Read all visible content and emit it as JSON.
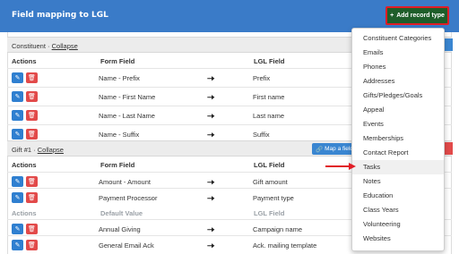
{
  "header": {
    "title": "Field mapping to LGL",
    "add_button": "Add record type",
    "add_icon": "+"
  },
  "sections": [
    {
      "label": "Constituent",
      "separator": " · ",
      "collapse": "Collapse",
      "columns": {
        "actions": "Actions",
        "form_field": "Form Field",
        "lgl_field": "LGL Field"
      },
      "rows": [
        {
          "form_field": "Name - Prefix",
          "lgl_field": "Prefix"
        },
        {
          "form_field": "Name - First Name",
          "lgl_field": "First name"
        },
        {
          "form_field": "Name - Last Name",
          "lgl_field": "Last name"
        },
        {
          "form_field": "Name - Suffix",
          "lgl_field": "Suffix"
        }
      ]
    },
    {
      "label": "Gift #1",
      "separator": " · ",
      "collapse": "Collapse",
      "map_button": "Map a field",
      "columns": {
        "actions": "Actions",
        "form_field": "Form Field",
        "lgl_field": "LGL Field"
      },
      "rows": [
        {
          "form_field": "Amount - Amount",
          "lgl_field": "Gift amount"
        },
        {
          "form_field": "Payment Processor",
          "lgl_field": "Payment type"
        }
      ],
      "default_columns": {
        "actions": "Actions",
        "default_value": "Default Value",
        "lgl_field": "LGL Field"
      },
      "default_rows": [
        {
          "default_value": "Annual Giving",
          "lgl_field": "Campaign name"
        },
        {
          "default_value": "General Email Ack",
          "lgl_field": "Ack. mailing template"
        }
      ]
    }
  ],
  "dropdown": {
    "items": [
      "Constituent Categories",
      "Emails",
      "Phones",
      "Addresses",
      "Gifts/Pledges/Goals",
      "Appeal",
      "Events",
      "Memberships",
      "Contact Report",
      "Tasks",
      "Notes",
      "Education",
      "Class Years",
      "Volunteering",
      "Websites"
    ],
    "highlighted": "Tasks"
  },
  "icons": {
    "edit": "edit-icon",
    "delete": "trash-icon",
    "arrow": "arrow-right-icon",
    "link": "link-icon"
  },
  "colors": {
    "header": "#3a7bc8",
    "add_button": "#1e5e2a",
    "highlight_border": "#e11d26",
    "edit": "#2f7fd0",
    "delete": "#e24a4a"
  }
}
